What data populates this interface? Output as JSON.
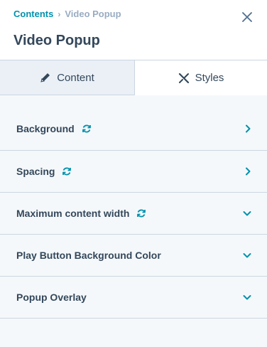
{
  "breadcrumb": {
    "parent": "Contents",
    "current": "Video Popup"
  },
  "title": "Video Popup",
  "tabs": [
    {
      "label": "Content",
      "icon": "pencil-icon",
      "active": false
    },
    {
      "label": "Styles",
      "icon": "brush-icon",
      "active": true
    }
  ],
  "sections": [
    {
      "label": "Background",
      "sync": true,
      "chevron": "right"
    },
    {
      "label": "Spacing",
      "sync": true,
      "chevron": "right"
    },
    {
      "label": "Maximum content width",
      "sync": true,
      "chevron": "down"
    },
    {
      "label": "Play Button Background Color",
      "sync": false,
      "chevron": "down"
    },
    {
      "label": "Popup Overlay",
      "sync": false,
      "chevron": "down"
    }
  ],
  "colors": {
    "accent": "#0091ae",
    "text": "#33475b",
    "muted": "#99acc2"
  }
}
